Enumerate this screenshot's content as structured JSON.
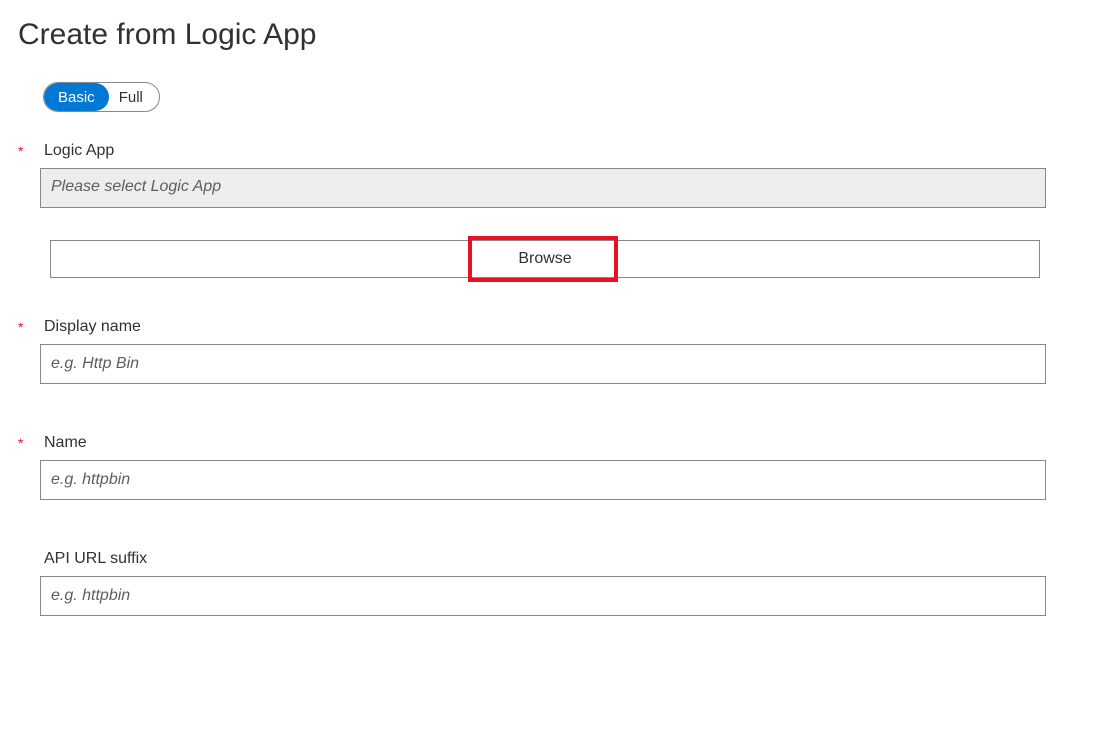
{
  "page": {
    "title": "Create from Logic App"
  },
  "toggle": {
    "basic": "Basic",
    "full": "Full"
  },
  "fields": {
    "logic_app": {
      "label": "Logic App",
      "placeholder": "Please select Logic App"
    },
    "browse": {
      "label": "Browse"
    },
    "display_name": {
      "label": "Display name",
      "placeholder": "e.g. Http Bin"
    },
    "name": {
      "label": "Name",
      "placeholder": "e.g. httpbin"
    },
    "api_url_suffix": {
      "label": "API URL suffix",
      "placeholder": "e.g. httpbin"
    }
  },
  "required_marker": "*"
}
